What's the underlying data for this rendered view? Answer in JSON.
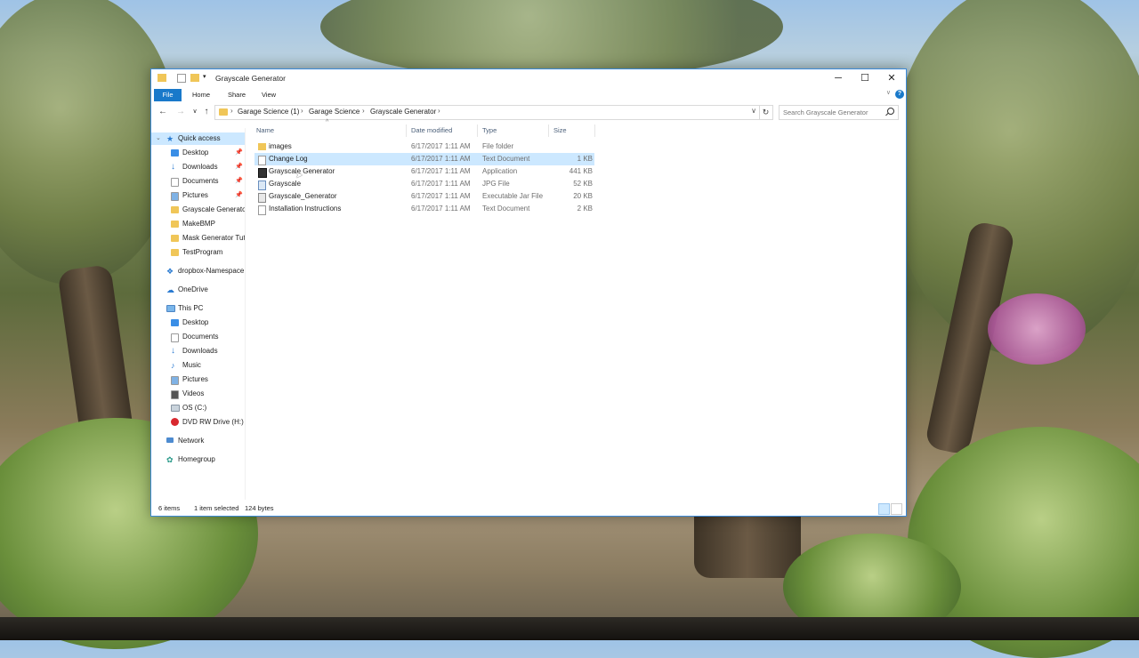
{
  "window": {
    "title": "Grayscale Generator",
    "controls": {
      "minimize": "─",
      "maximize": "☐",
      "close": "✕"
    }
  },
  "ribbon": {
    "tabs": [
      "File",
      "Home",
      "Share",
      "View"
    ],
    "help": "?"
  },
  "address": {
    "crumbs": [
      "Garage Science (1)",
      "Garage Science",
      "Grayscale Generator"
    ],
    "search_placeholder": "Search Grayscale Generator"
  },
  "nav_pane": {
    "quick_access": "Quick access",
    "quick_items": [
      "Desktop",
      "Downloads",
      "Documents",
      "Pictures",
      "Grayscale Generator",
      "MakeBMP",
      "Mask Generator Tut",
      "TestProgram"
    ],
    "dropbox": "dropbox-Namespace",
    "onedrive": "OneDrive",
    "this_pc": "This PC",
    "pc_items": [
      "Desktop",
      "Documents",
      "Downloads",
      "Music",
      "Pictures",
      "Videos",
      "OS (C:)",
      "DVD RW Drive (H:) T"
    ],
    "network": "Network",
    "homegroup": "Homegroup"
  },
  "columns": [
    "Name",
    "Date modified",
    "Type",
    "Size"
  ],
  "files": [
    {
      "name": "images",
      "date": "6/17/2017 1:11 AM",
      "type": "File folder",
      "size": "",
      "icon": "folder-icon",
      "selected": false
    },
    {
      "name": "Change Log",
      "date": "6/17/2017 1:11 AM",
      "type": "Text Document",
      "size": "1 KB",
      "icon": "text-document-icon",
      "selected": true
    },
    {
      "name": "Grayscale Generator",
      "date": "6/17/2017 1:11 AM",
      "type": "Application",
      "size": "441 KB",
      "icon": "application-icon",
      "selected": false
    },
    {
      "name": "Grayscale",
      "date": "6/17/2017 1:11 AM",
      "type": "JPG File",
      "size": "52 KB",
      "icon": "image-file-icon",
      "selected": false
    },
    {
      "name": "Grayscale_Generator",
      "date": "6/17/2017 1:11 AM",
      "type": "Executable Jar File",
      "size": "20 KB",
      "icon": "jar-file-icon",
      "selected": false
    },
    {
      "name": "Installation Instructions",
      "date": "6/17/2017 1:11 AM",
      "type": "Text Document",
      "size": "2 KB",
      "icon": "text-document-icon",
      "selected": false
    }
  ],
  "status": {
    "item_count": "6 items",
    "selection": "1 item selected",
    "selection_size": "124 bytes"
  },
  "colors": {
    "accent": "#1979ca",
    "selection": "#cce8ff",
    "folder": "#f0c658"
  }
}
